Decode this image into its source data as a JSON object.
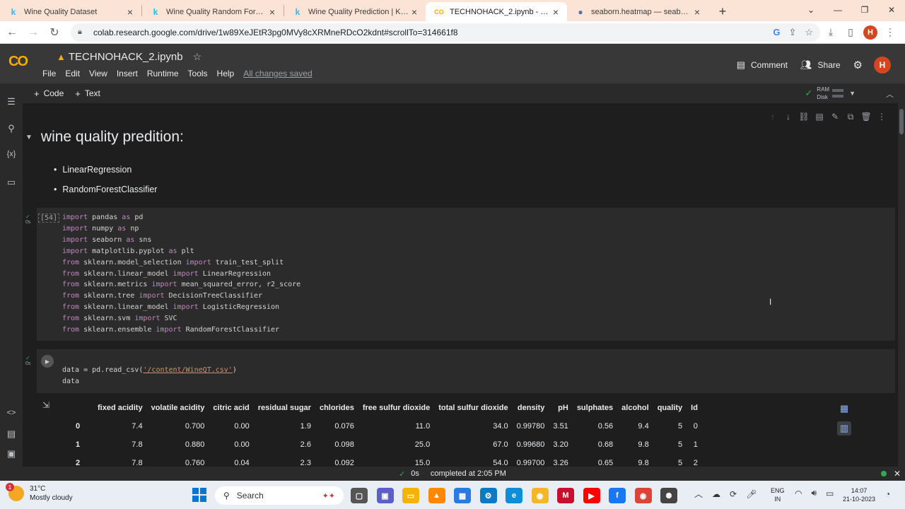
{
  "browser": {
    "tabs": [
      {
        "title": "Wine Quality Dataset",
        "favicon": "kaggle-icon",
        "active": false
      },
      {
        "title": "Wine Quality Random Forest Cl",
        "favicon": "kaggle-icon",
        "active": false
      },
      {
        "title": "Wine Quality Prediction | Kaggle",
        "favicon": "kaggle-icon",
        "active": false
      },
      {
        "title": "TECHNOHACK_2.ipynb - Colabo",
        "favicon": "colab-icon",
        "active": true
      },
      {
        "title": "seaborn.heatmap — seaborn 0",
        "favicon": "seaborn-icon",
        "active": false
      }
    ],
    "url": "colab.research.google.com/drive/1w89XeJEtR3pg0MVy8cXRMneRDcO2kdnt#scrollTo=314661f8",
    "profile_initial": "H"
  },
  "colab": {
    "logo": "CO",
    "notebook_title": "TECHNOHACK_2.ipynb",
    "menu": [
      "File",
      "Edit",
      "View",
      "Insert",
      "Runtime",
      "Tools",
      "Help"
    ],
    "save_status": "All changes saved",
    "comment_label": "Comment",
    "share_label": "Share",
    "avatar_initial": "H",
    "toolbar": {
      "code_label": "Code",
      "text_label": "Text",
      "ram_label": "RAM",
      "disk_label": "Disk"
    }
  },
  "markdown": {
    "heading": "wine quality predition:",
    "items": [
      "LinearRegression",
      "RandomForestClassifier"
    ]
  },
  "cell1": {
    "exec_count": "[54]",
    "time": "0s"
  },
  "cell2": {
    "time": "0s",
    "code_lines": [
      "data = pd.read_csv('/content/WineQT.csv')",
      "data"
    ]
  },
  "dataframe": {
    "columns": [
      "fixed acidity",
      "volatile acidity",
      "citric acid",
      "residual sugar",
      "chlorides",
      "free sulfur dioxide",
      "total sulfur dioxide",
      "density",
      "pH",
      "sulphates",
      "alcohol",
      "quality",
      "Id"
    ],
    "rows": [
      {
        "index": "0",
        "values": [
          "7.4",
          "0.700",
          "0.00",
          "1.9",
          "0.076",
          "11.0",
          "34.0",
          "0.99780",
          "3.51",
          "0.56",
          "9.4",
          "5",
          "0"
        ]
      },
      {
        "index": "1",
        "values": [
          "7.8",
          "0.880",
          "0.00",
          "2.6",
          "0.098",
          "25.0",
          "67.0",
          "0.99680",
          "3.20",
          "0.68",
          "9.8",
          "5",
          "1"
        ]
      },
      {
        "index": "2",
        "values": [
          "7.8",
          "0.760",
          "0.04",
          "2.3",
          "0.092",
          "15.0",
          "54.0",
          "0.99700",
          "3.26",
          "0.65",
          "9.8",
          "5",
          "2"
        ]
      }
    ]
  },
  "status": {
    "duration": "0s",
    "message": "completed at 2:05 PM"
  },
  "taskbar": {
    "notification_count": "1",
    "temperature": "31°C",
    "weather": "Mostly cloudy",
    "search_label": "Search",
    "lang_line1": "ENG",
    "lang_line2": "IN",
    "time": "14:07",
    "date": "21-10-2023"
  }
}
